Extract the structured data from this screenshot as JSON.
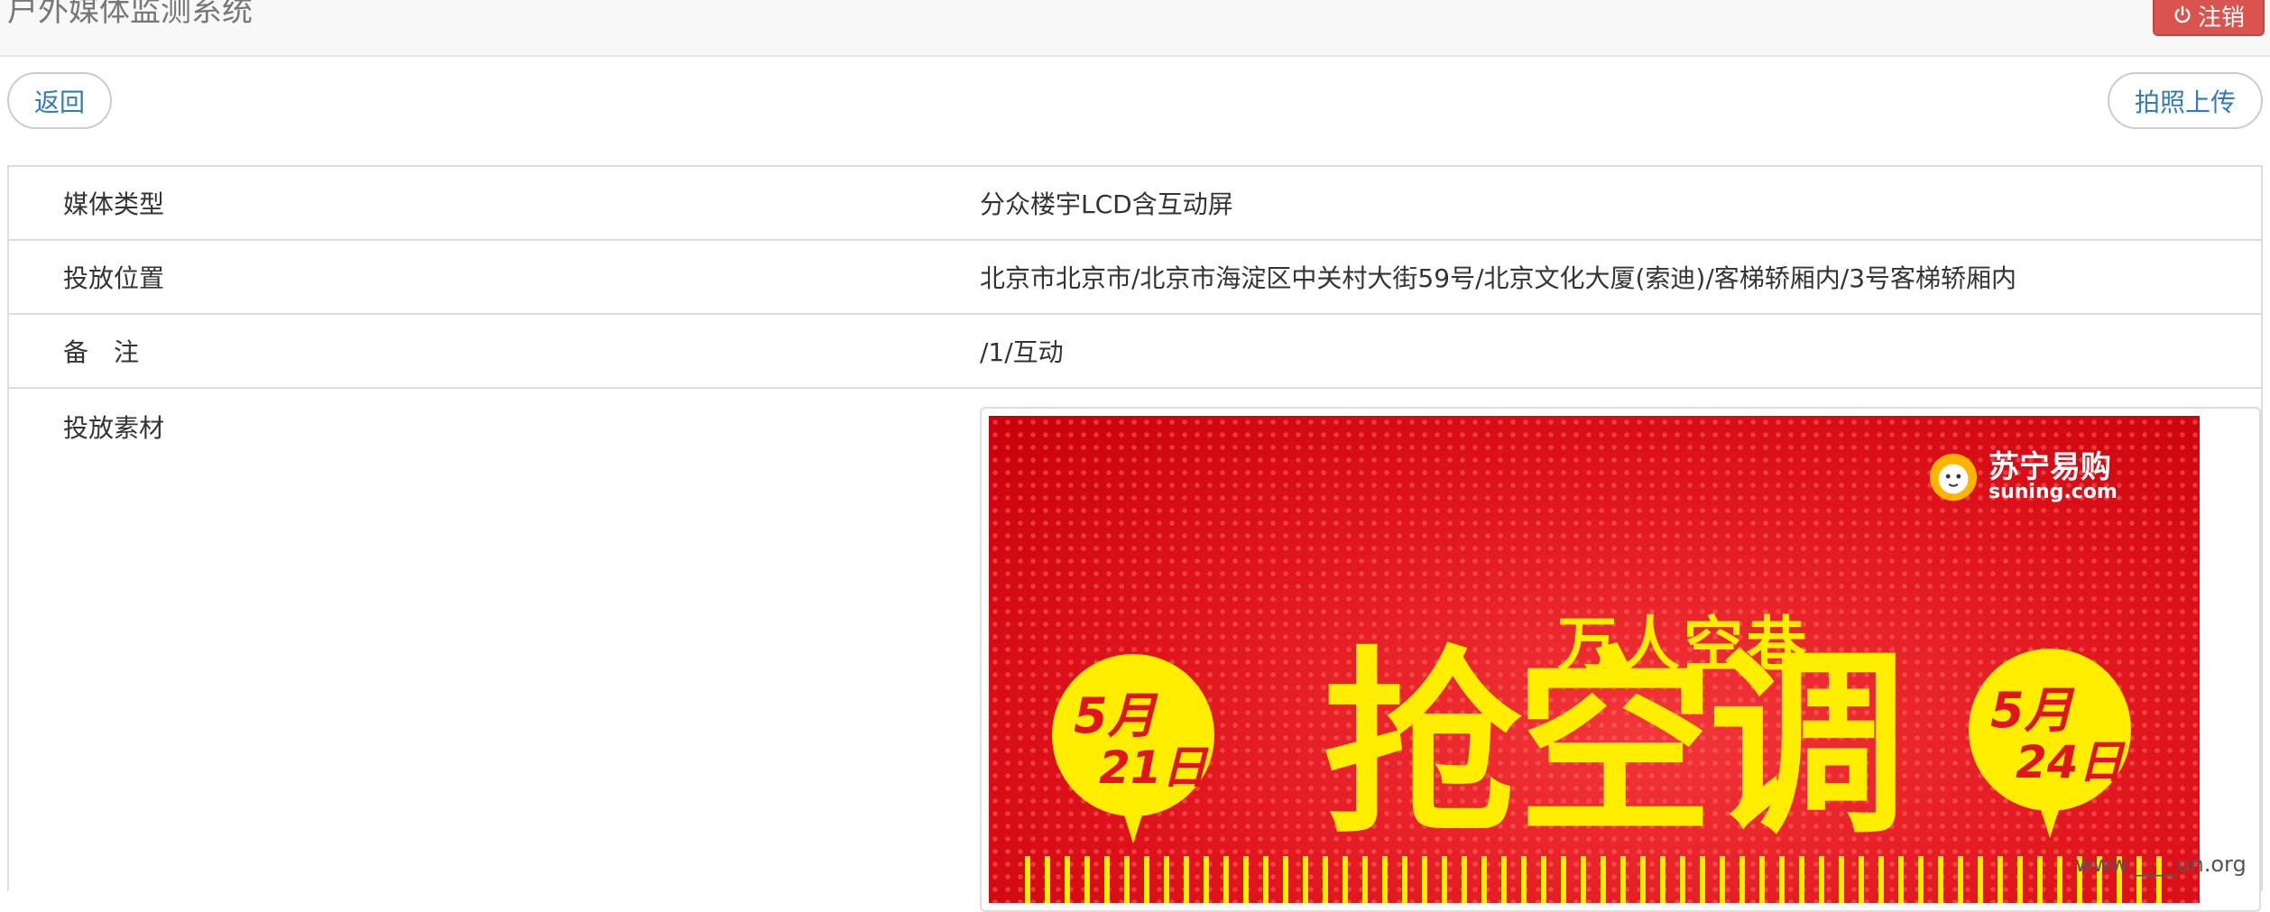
{
  "navbar": {
    "brand": "户外媒体监测系统",
    "logout_label": "注销"
  },
  "actions": {
    "back_label": "返回",
    "upload_label": "拍照上传"
  },
  "details": {
    "rows": [
      {
        "label": "媒体类型",
        "value": "分众楼宇LCD含互动屏"
      },
      {
        "label": "投放位置",
        "value": "北京市北京市/北京市海淀区中关村大街59号/北京文化大厦(索迪)/客梯轿厢内/3号客梯轿厢内"
      },
      {
        "label": "备　注",
        "value": "/1/互动"
      },
      {
        "label": "投放素材"
      }
    ]
  },
  "poster": {
    "brand_cn": "苏宁易购",
    "brand_en": "suning.com",
    "headline_small": "万人空巷",
    "headline_big": "抢空调",
    "left_bubble": {
      "month": "5月",
      "day": "21日"
    },
    "right_bubble": {
      "month": "5月",
      "day": "24日"
    }
  },
  "watermark": "www.____un.org",
  "colors": {
    "danger": "#d9534f",
    "link": "#337ab7",
    "poster_red": "#e0141c",
    "poster_yellow": "#ffee00"
  },
  "icons": {
    "logout": "power-icon",
    "brand_logo": "lion-icon"
  }
}
